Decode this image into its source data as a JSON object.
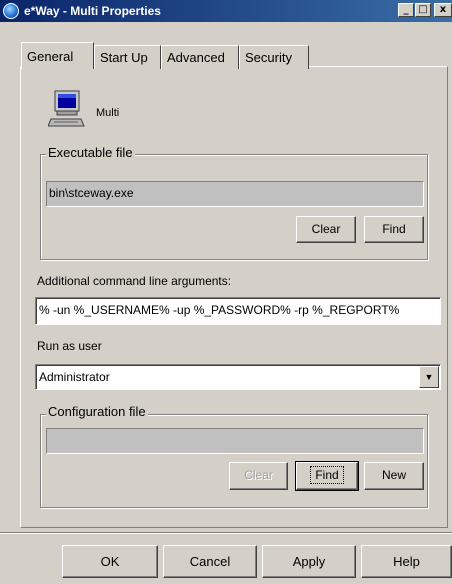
{
  "window": {
    "title": "e*Way - Multi Properties",
    "controls": {
      "minimize": "_",
      "maximize": "□",
      "close": "x"
    }
  },
  "tabs": [
    {
      "label": "General",
      "active": true
    },
    {
      "label": "Start Up",
      "active": false
    },
    {
      "label": "Advanced",
      "active": false
    },
    {
      "label": "Security",
      "active": false
    }
  ],
  "general": {
    "icon": "computer-icon",
    "name": "Multi",
    "executable_group": {
      "title": "Executable file",
      "value": "bin\\stceway.exe",
      "clear_label": "Clear",
      "find_label": "Find"
    },
    "args_label": "Additional command line arguments:",
    "args_value": "% -un %_USERNAME% -up %_PASSWORD% -rp %_REGPORT%",
    "run_as_label": "Run as user",
    "run_as_value": "Administrator",
    "config_group": {
      "title": "Configuration file",
      "value": "",
      "clear_label": "Clear",
      "find_label": "Find",
      "new_label": "New"
    }
  },
  "footer": {
    "ok_label": "OK",
    "cancel_label": "Cancel",
    "apply_label": "Apply",
    "help_label": "Help"
  }
}
